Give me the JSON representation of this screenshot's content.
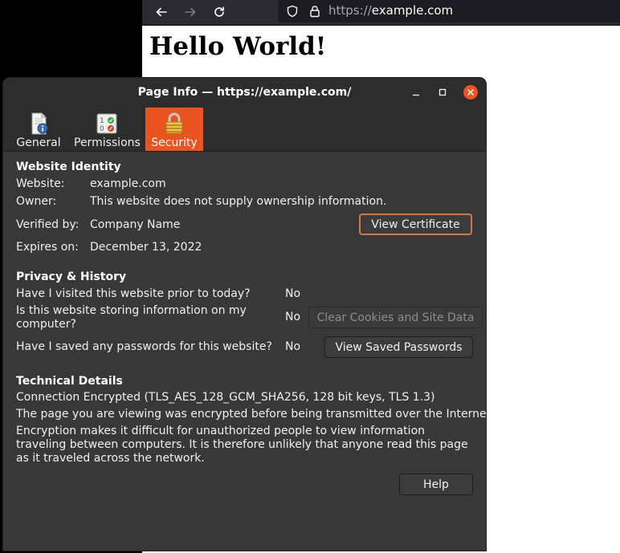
{
  "browser": {
    "url_scheme": "https://",
    "url_host": "example.com",
    "page_heading": "Hello World!"
  },
  "dialog": {
    "title": "Page Info — https://example.com/",
    "tabs": [
      {
        "label": "General",
        "icon": "page-info-icon"
      },
      {
        "label": "Permissions",
        "icon": "permissions-icon"
      },
      {
        "label": "Security",
        "icon": "lock-icon",
        "active": true
      }
    ],
    "identity": {
      "heading": "Website Identity",
      "website_label": "Website:",
      "website_value": "example.com",
      "owner_label": "Owner:",
      "owner_value": "This website does not supply ownership information.",
      "verified_label": "Verified by:",
      "verified_value": "Company Name",
      "expires_label": "Expires on:",
      "expires_value": "December 13, 2022",
      "view_certificate": "View Certificate"
    },
    "privacy": {
      "heading": "Privacy & History",
      "q_visited": "Have I visited this website prior to today?",
      "a_visited": "No",
      "q_storing": "Is this website storing information on my computer?",
      "a_storing": "No",
      "clear_cookies": "Clear Cookies and Site Data",
      "q_passwords": "Have I saved any passwords for this website?",
      "a_passwords": "No",
      "view_passwords": "View Saved Passwords"
    },
    "technical": {
      "heading": "Technical Details",
      "line1": "Connection Encrypted (TLS_AES_128_GCM_SHA256, 128 bit keys, TLS 1.3)",
      "line2": "The page you are viewing was encrypted before being transmitted over the Internet.",
      "line3": "Encryption makes it difficult for unauthorized people to view information traveling between computers. It is therefore unlikely that anyone read this page as it traveled across the network."
    },
    "help": "Help"
  },
  "colors": {
    "accent": "#e95420",
    "dialog_bg": "#383838",
    "titlebar_bg": "#2d2d2d"
  }
}
